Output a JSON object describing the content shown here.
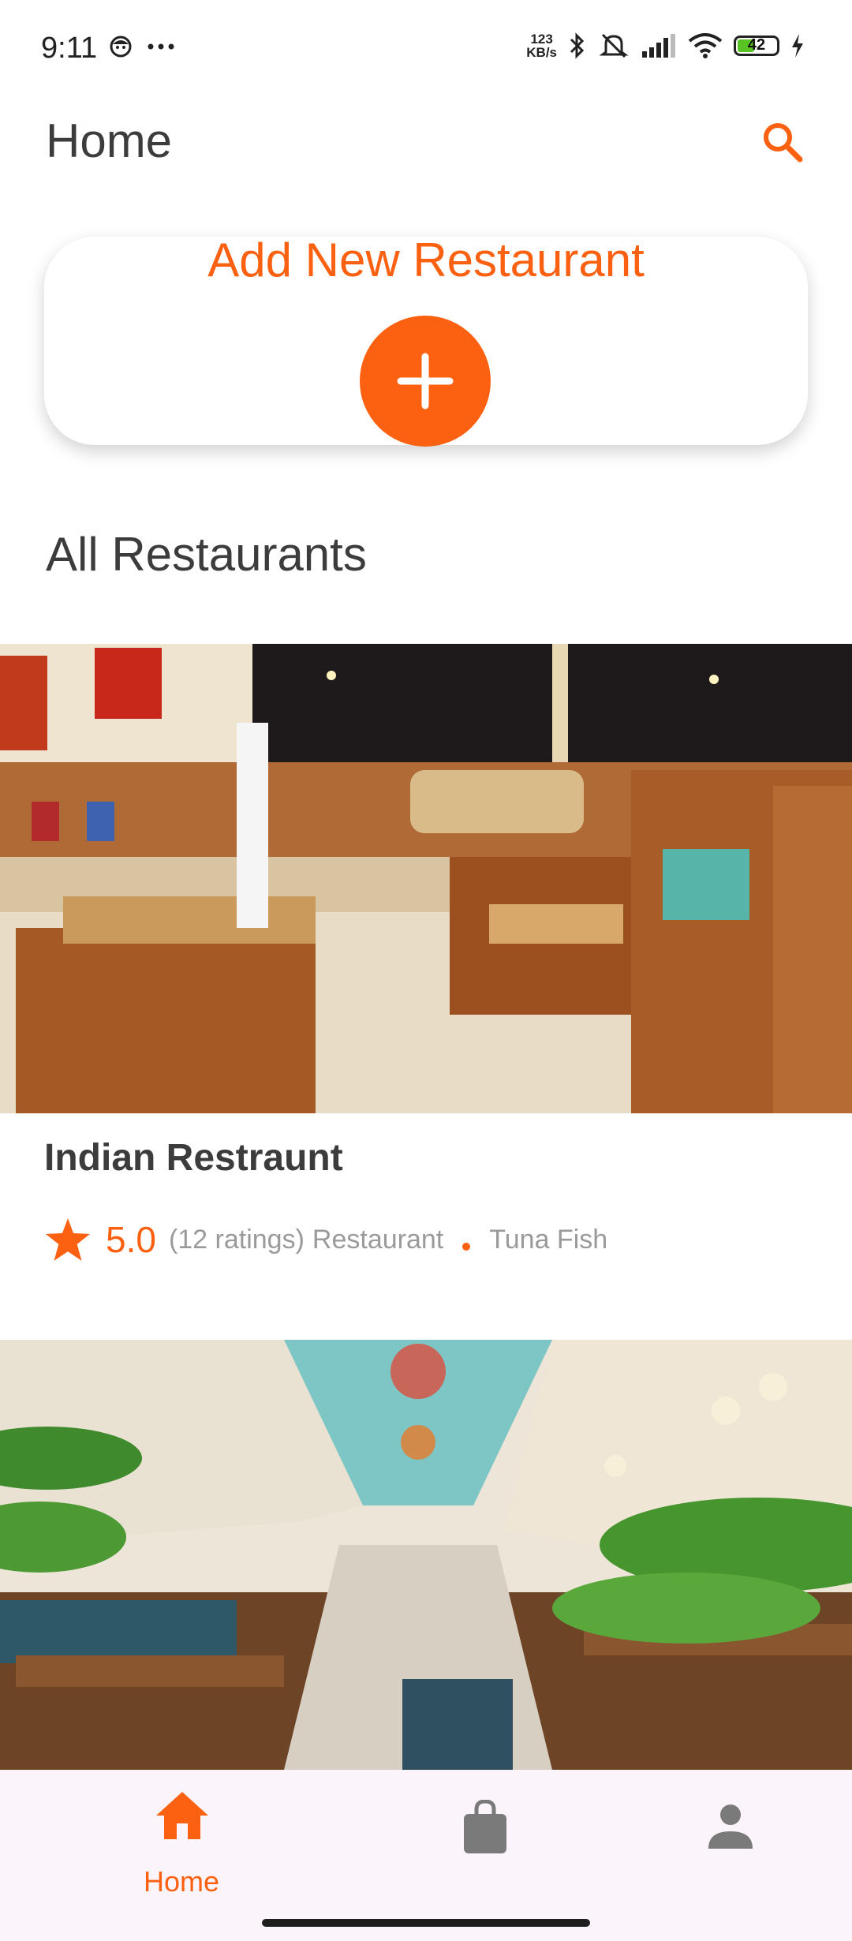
{
  "status_bar": {
    "time": "9:11",
    "net_speed_value": "123",
    "net_speed_unit": "KB/s",
    "battery_level": "42",
    "icons": [
      "face-icon",
      "more-dots-icon",
      "bluetooth-icon",
      "silent-icon",
      "signal-icon",
      "wifi-icon",
      "battery-icon",
      "charging-icon"
    ]
  },
  "header": {
    "title": "Home",
    "search_icon": "search-icon"
  },
  "add_card": {
    "title": "Add New Restaurant",
    "button_icon": "plus-icon"
  },
  "section": {
    "title": "All Restaurants"
  },
  "restaurants": [
    {
      "name": "Indian Restraunt",
      "rating": "5.0",
      "ratings_count": "(12 ratings)",
      "type": "Restaurant",
      "cuisine": "Tuna Fish"
    },
    {
      "name": "",
      "rating": "",
      "ratings_count": "",
      "type": "",
      "cuisine": ""
    }
  ],
  "bottom_nav": {
    "items": [
      {
        "label": "Home",
        "icon": "home-icon",
        "active": true
      },
      {
        "label": "",
        "icon": "shopping-bag-icon",
        "active": false
      },
      {
        "label": "",
        "icon": "person-icon",
        "active": false
      }
    ]
  },
  "colors": {
    "accent": "#fc6011",
    "text_primary": "#3c3c3c",
    "text_secondary": "#9a9a9a",
    "nav_background": "#fcf4fb",
    "icon_inactive": "#7a7a7a"
  }
}
